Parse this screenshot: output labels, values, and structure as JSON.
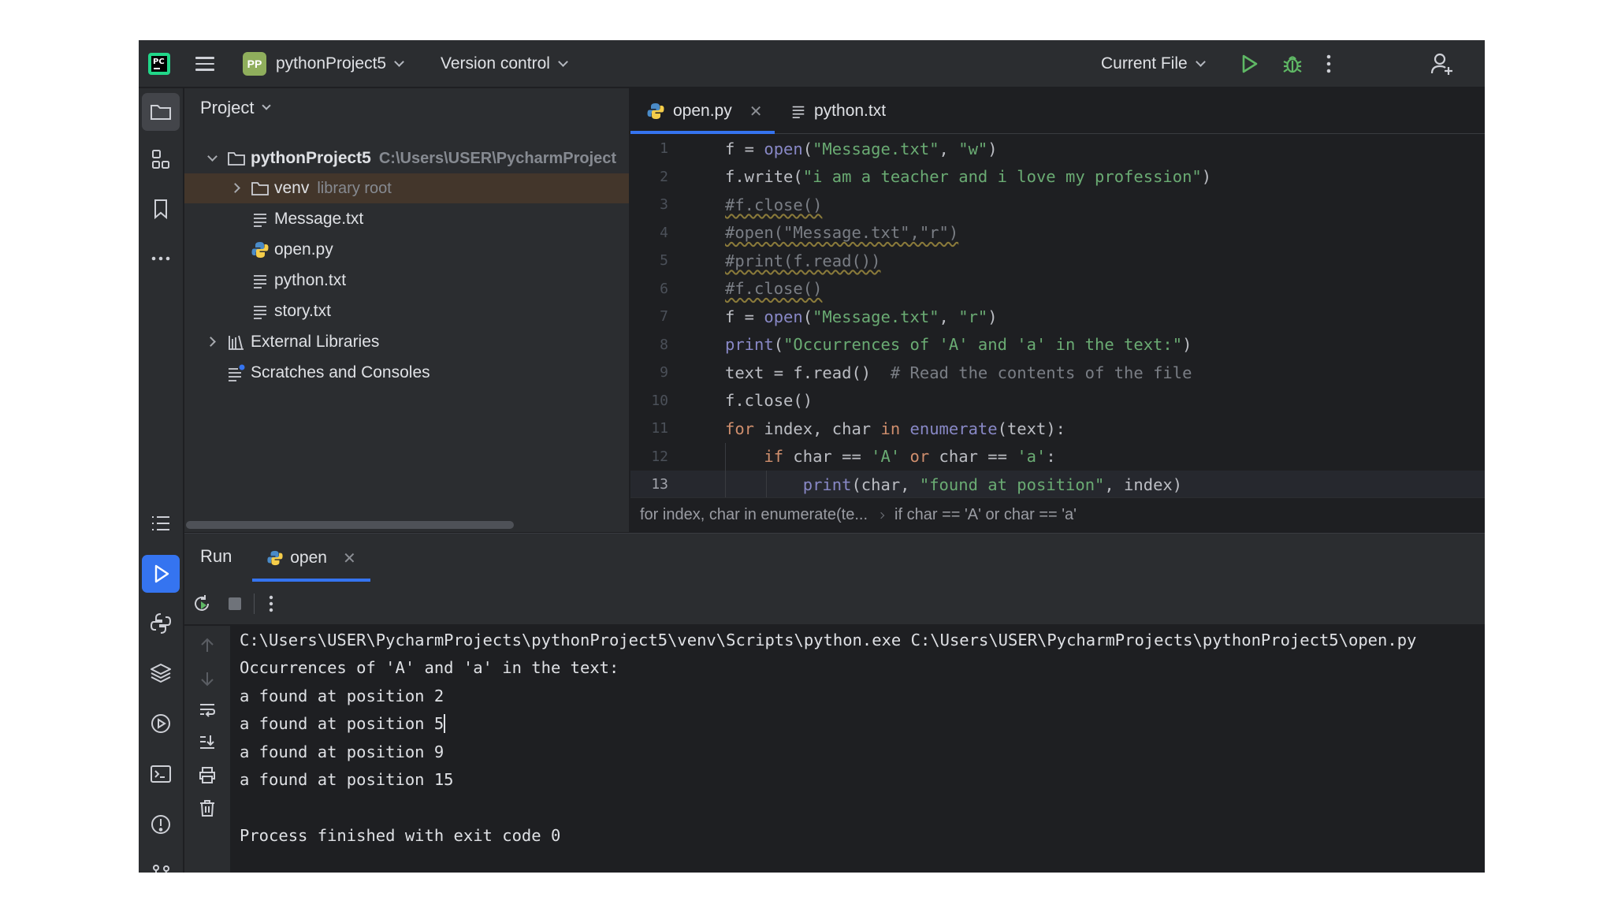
{
  "titlebar": {
    "project_badge": "PP",
    "project_name": "pythonProject5",
    "vcs_label": "Version control",
    "run_config": "Current File"
  },
  "project_panel": {
    "title": "Project",
    "tree": [
      {
        "label": "pythonProject5",
        "hint": "C:\\Users\\USER\\PycharmProject",
        "icon": "folder-icon"
      },
      {
        "label": "venv",
        "hint": "library root",
        "icon": "folder-icon"
      },
      {
        "label": "Message.txt",
        "icon": "text-file-icon"
      },
      {
        "label": "open.py",
        "icon": "python-file-icon"
      },
      {
        "label": "python.txt",
        "icon": "text-file-icon"
      },
      {
        "label": "story.txt",
        "icon": "text-file-icon"
      },
      {
        "label": "External Libraries",
        "icon": "library-icon"
      },
      {
        "label": "Scratches and Consoles",
        "icon": "scratches-icon"
      }
    ]
  },
  "editor": {
    "tabs": [
      {
        "label": "open.py",
        "icon": "python-file-icon",
        "active": true
      },
      {
        "label": "python.txt",
        "icon": "text-file-icon",
        "active": false
      }
    ],
    "line_numbers": [
      "1",
      "2",
      "3",
      "4",
      "5",
      "6",
      "7",
      "8",
      "9",
      "10",
      "11",
      "12",
      "13"
    ],
    "current_line": 13,
    "breadcrumbs": [
      "for index, char in enumerate(te...",
      "if char == 'A' or char == 'a'"
    ]
  },
  "run_panel": {
    "title": "Run",
    "tab_label": "open",
    "console_lines": [
      "C:\\Users\\USER\\PycharmProjects\\pythonProject5\\venv\\Scripts\\python.exe C:\\Users\\USER\\PycharmProjects\\pythonProject5\\open.py",
      "Occurrences of 'A' and 'a' in the text:",
      "a found at position 2",
      "a found at position 5",
      "a found at position 9",
      "a found at position 15",
      "",
      "Process finished with exit code 0"
    ]
  },
  "colors": {
    "accent": "#3574f0",
    "run_green": "#5fb865",
    "keyword": "#cf8e6d",
    "string": "#6aab73",
    "builtin": "#8888c6",
    "comment": "#7a7e85"
  }
}
